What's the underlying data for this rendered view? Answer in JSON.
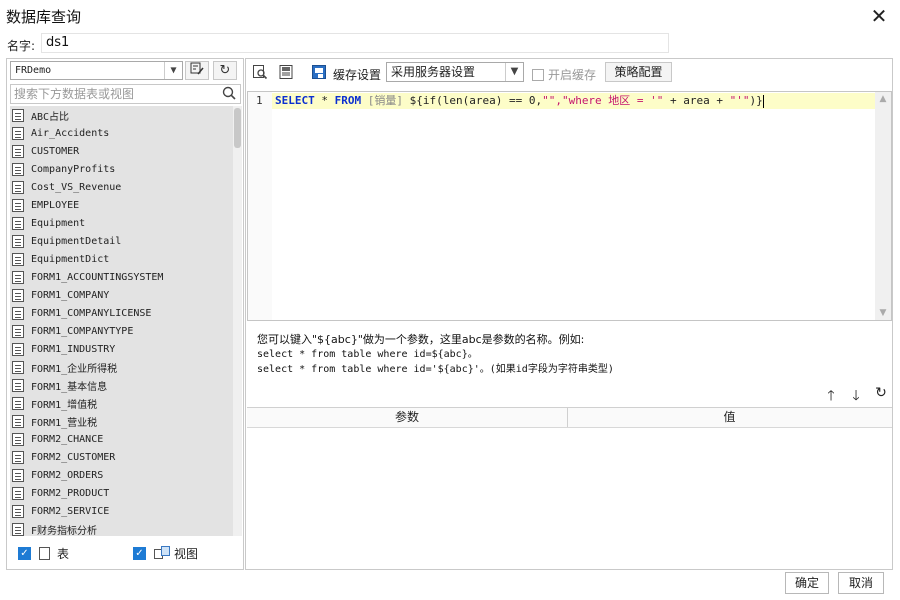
{
  "window": {
    "title": "数据库查询",
    "close_label": "✕"
  },
  "name_row": {
    "label": "名字:",
    "value": "ds1"
  },
  "left_panel": {
    "database": "FRDemo",
    "search_placeholder": "搜索下方数据表或视图",
    "tables": [
      "ABC占比",
      "Air_Accidents",
      "CUSTOMER",
      "CompanyProfits",
      "Cost_VS_Revenue",
      "EMPLOYEE",
      "Equipment",
      "EquipmentDetail",
      "EquipmentDict",
      "FORM1_ACCOUNTINGSYSTEM",
      "FORM1_COMPANY",
      "FORM1_COMPANYLICENSE",
      "FORM1_COMPANYTYPE",
      "FORM1_INDUSTRY",
      "FORM1_企业所得税",
      "FORM1_基本信息",
      "FORM1_增值税",
      "FORM1_营业税",
      "FORM2_CHANCE",
      "FORM2_CUSTOMER",
      "FORM2_ORDERS",
      "FORM2_PRODUCT",
      "FORM2_SERVICE",
      "F财务指标分析"
    ],
    "show_tables_label": "表",
    "show_views_label": "视图"
  },
  "toolbar": {
    "cache_label": "缓存设置",
    "cache_option": "采用服务器设置",
    "enable_cache_label": "开启缓存",
    "strategy_label": "策略配置"
  },
  "editor": {
    "line_number": "1",
    "sql_kw1": "SELECT",
    "sql_mid1": " * ",
    "sql_kw2": "FROM",
    "sql_table": " [销量] ",
    "sql_expr1": "${if(len(area) == 0,",
    "sql_str1": "\"\",\"where 地区 = '\"",
    "sql_expr2": " + area + ",
    "sql_str2": "\"'\"",
    "sql_expr3": ")}"
  },
  "hint": {
    "line1": "您可以键入\"${abc}\"做为一个参数，这里abc是参数的名称。例如:",
    "line2": "select * from table where id=${abc}。",
    "line3": "select * from table where id='${abc}'。(如果id字段为字符串类型)"
  },
  "params": {
    "col_param": "参数",
    "col_value": "值"
  },
  "footer": {
    "ok_label": "确定",
    "cancel_label": "取消"
  },
  "colors": {
    "sql_keyword": "#0b2fd0",
    "sql_string": "#c4136d",
    "checkbox": "#1e7bd4",
    "active_line": "#fdfdc8"
  }
}
